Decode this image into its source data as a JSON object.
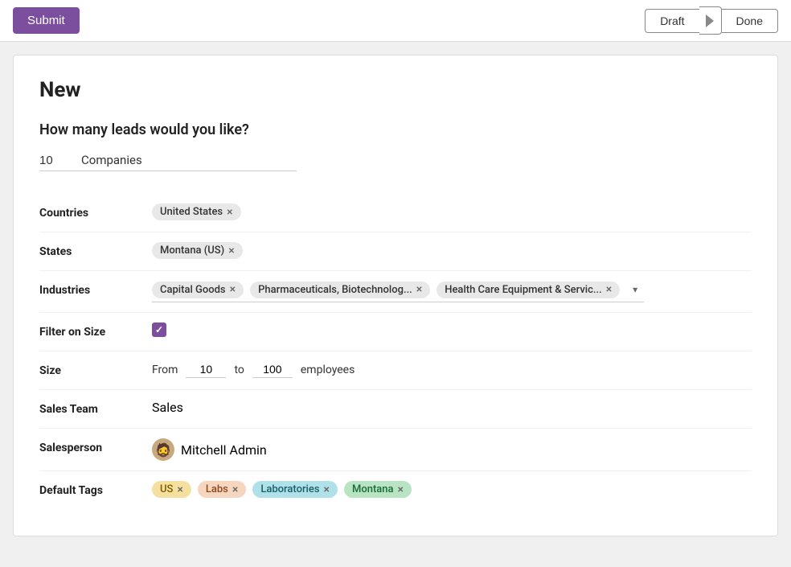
{
  "topbar": {
    "submit_label": "Submit",
    "draft_label": "Draft",
    "done_label": "Done"
  },
  "page": {
    "title": "New",
    "question": "How many leads would you like?",
    "leads_count": "10",
    "leads_type": "Companies"
  },
  "fields": {
    "countries_label": "Countries",
    "states_label": "States",
    "industries_label": "Industries",
    "filter_on_size_label": "Filter on Size",
    "size_label": "Size",
    "size_from_label": "From",
    "size_from_value": "10",
    "size_to_label": "to",
    "size_to_value": "100",
    "size_suffix": "employees",
    "sales_team_label": "Sales Team",
    "sales_team_value": "Sales",
    "salesperson_label": "Salesperson",
    "salesperson_name": "Mitchell Admin",
    "default_tags_label": "Default Tags"
  },
  "tags": {
    "countries": [
      {
        "label": "United States",
        "removable": true
      }
    ],
    "states": [
      {
        "label": "Montana (US)",
        "removable": true
      }
    ],
    "industries": [
      {
        "label": "Capital Goods",
        "removable": true
      },
      {
        "label": "Pharmaceuticals, Biotechnolog...",
        "removable": true
      },
      {
        "label": "Health Care Equipment & Servic...",
        "removable": true
      }
    ],
    "default_tags": [
      {
        "label": "US",
        "color": "yellow",
        "removable": true
      },
      {
        "label": "Labs",
        "color": "peach",
        "removable": true
      },
      {
        "label": "Laboratories",
        "color": "teal",
        "removable": true
      },
      {
        "label": "Montana",
        "color": "green",
        "removable": true
      }
    ]
  },
  "icons": {
    "checkmark": "✓",
    "close": "×",
    "chevron_down": "▾",
    "chevron_right": "▶",
    "avatar_emoji": "🧔"
  }
}
